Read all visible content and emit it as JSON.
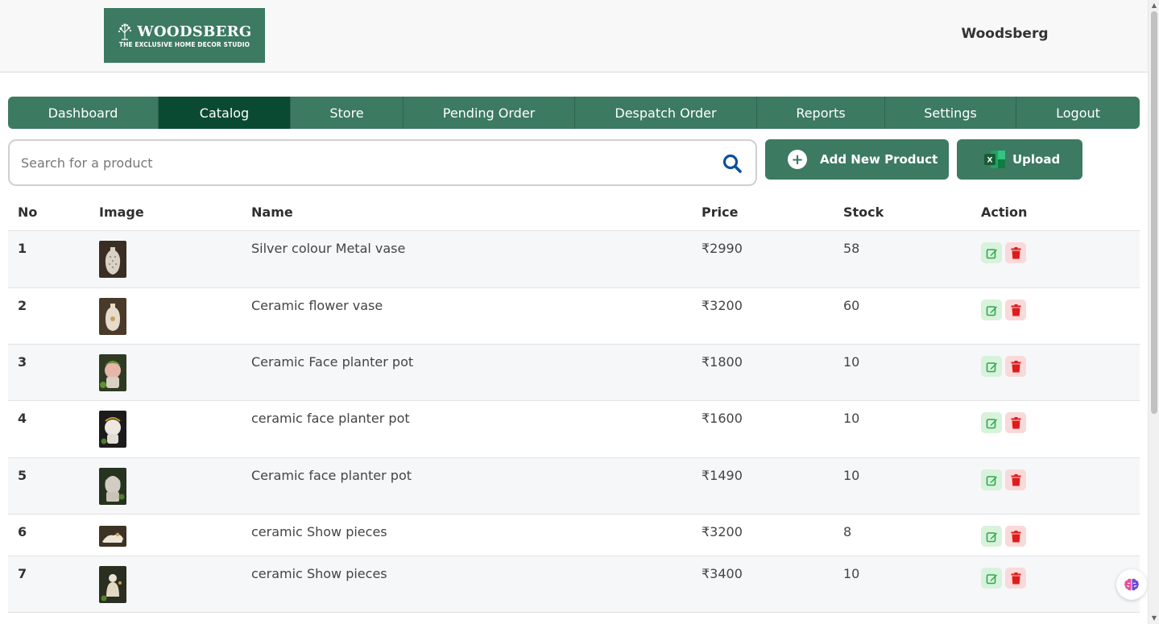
{
  "header": {
    "logo_name": "WOODSBERG",
    "logo_tagline": "THE EXCLUSIVE HOME DECOR STUDIO",
    "user_name": "Woodsberg"
  },
  "nav": {
    "items": [
      {
        "label": "Dashboard"
      },
      {
        "label": "Catalog",
        "active": true
      },
      {
        "label": "Store"
      },
      {
        "label": "Pending Order"
      },
      {
        "label": "Despatch Order"
      },
      {
        "label": "Reports"
      },
      {
        "label": "Settings"
      },
      {
        "label": "Logout"
      }
    ]
  },
  "search": {
    "placeholder": "Search for a product",
    "value": "",
    "icon": "search-icon"
  },
  "buttons": {
    "add_label": "Add New Product",
    "upload_label": "Upload"
  },
  "table": {
    "headers": [
      "No",
      "Image",
      "Name",
      "Price",
      "Stock",
      "Action"
    ],
    "rows": [
      {
        "no": "1",
        "name": "Silver colour Metal vase",
        "price": "₹2990",
        "stock": "58"
      },
      {
        "no": "2",
        "name": "Ceramic flower vase",
        "price": "₹3200",
        "stock": "60"
      },
      {
        "no": "3",
        "name": "Ceramic Face planter pot",
        "price": "₹1800",
        "stock": "10"
      },
      {
        "no": "4",
        "name": "ceramic face planter pot",
        "price": "₹1600",
        "stock": "10"
      },
      {
        "no": "5",
        "name": "Ceramic face planter pot",
        "price": "₹1490",
        "stock": "10"
      },
      {
        "no": "6",
        "name": "ceramic Show pieces",
        "price": "₹3200",
        "stock": "8"
      },
      {
        "no": "7",
        "name": "ceramic Show pieces",
        "price": "₹3400",
        "stock": "10"
      }
    ]
  },
  "colors": {
    "brand": "#3c7a62",
    "nav_active": "#0b4a32",
    "edit": "#2fa84f",
    "delete": "#e01b1b",
    "search_icon": "#0b4f9c"
  }
}
